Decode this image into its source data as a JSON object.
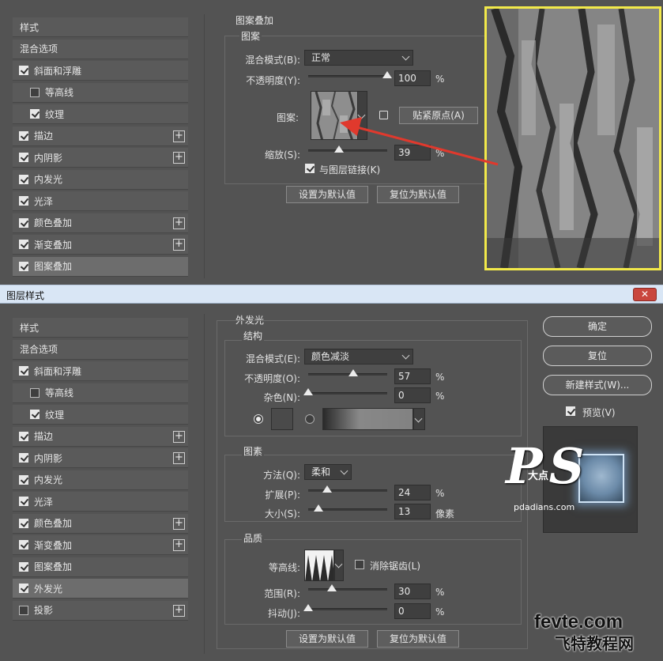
{
  "top": {
    "left_items": [
      {
        "label": "样式",
        "check": "none",
        "plus": false,
        "indent": false,
        "selected": false
      },
      {
        "label": "混合选项",
        "check": "none",
        "plus": false,
        "indent": false,
        "selected": false
      },
      {
        "label": "斜面和浮雕",
        "check": "on",
        "plus": false,
        "indent": false,
        "selected": false
      },
      {
        "label": "等高线",
        "check": "off",
        "plus": false,
        "indent": true,
        "selected": false
      },
      {
        "label": "纹理",
        "check": "on",
        "plus": false,
        "indent": true,
        "selected": false
      },
      {
        "label": "描边",
        "check": "on",
        "plus": true,
        "indent": false,
        "selected": false
      },
      {
        "label": "内阴影",
        "check": "on",
        "plus": true,
        "indent": false,
        "selected": false
      },
      {
        "label": "内发光",
        "check": "on",
        "plus": false,
        "indent": false,
        "selected": false
      },
      {
        "label": "光泽",
        "check": "on",
        "plus": false,
        "indent": false,
        "selected": false
      },
      {
        "label": "颜色叠加",
        "check": "on",
        "plus": true,
        "indent": false,
        "selected": false
      },
      {
        "label": "渐变叠加",
        "check": "on",
        "plus": true,
        "indent": false,
        "selected": false
      },
      {
        "label": "图案叠加",
        "check": "on",
        "plus": false,
        "indent": false,
        "selected": true
      }
    ],
    "section_title": "图案叠加",
    "group_title": "图案",
    "blend_label": "混合模式(B):",
    "blend_value": "正常",
    "opacity_label": "不透明度(Y):",
    "opacity_value": "100",
    "opacity_level": 100,
    "percent": "%",
    "pattern_label": "图案:",
    "snap_button": "贴紧原点(A)",
    "scale_label": "缩放(S):",
    "scale_value": "39",
    "scale_level": 39,
    "link_label": "与图层链接(K)",
    "default_button": "设置为默认值",
    "reset_button": "复位为默认值"
  },
  "dialog": {
    "title": "图层样式",
    "close": "✕",
    "left_items": [
      {
        "label": "样式",
        "check": "none",
        "plus": false,
        "indent": false,
        "selected": false
      },
      {
        "label": "混合选项",
        "check": "none",
        "plus": false,
        "indent": false,
        "selected": false
      },
      {
        "label": "斜面和浮雕",
        "check": "on",
        "plus": false,
        "indent": false,
        "selected": false
      },
      {
        "label": "等高线",
        "check": "off",
        "plus": false,
        "indent": true,
        "selected": false
      },
      {
        "label": "纹理",
        "check": "on",
        "plus": false,
        "indent": true,
        "selected": false
      },
      {
        "label": "描边",
        "check": "on",
        "plus": true,
        "indent": false,
        "selected": false
      },
      {
        "label": "内阴影",
        "check": "on",
        "plus": true,
        "indent": false,
        "selected": false
      },
      {
        "label": "内发光",
        "check": "on",
        "plus": false,
        "indent": false,
        "selected": false
      },
      {
        "label": "光泽",
        "check": "on",
        "plus": false,
        "indent": false,
        "selected": false
      },
      {
        "label": "颜色叠加",
        "check": "on",
        "plus": true,
        "indent": false,
        "selected": false
      },
      {
        "label": "渐变叠加",
        "check": "on",
        "plus": true,
        "indent": false,
        "selected": false
      },
      {
        "label": "图案叠加",
        "check": "on",
        "plus": false,
        "indent": false,
        "selected": false
      },
      {
        "label": "外发光",
        "check": "on",
        "plus": false,
        "indent": false,
        "selected": true
      },
      {
        "label": "投影",
        "check": "off",
        "plus": true,
        "indent": false,
        "selected": false
      }
    ],
    "section_title": "外发光",
    "structure": {
      "title": "结构",
      "blend_label": "混合模式(E):",
      "blend_value": "颜色减淡",
      "opacity_label": "不透明度(O):",
      "opacity_value": "57",
      "opacity_level": 57,
      "noise_label": "杂色(N):",
      "noise_value": "0",
      "noise_level": 0
    },
    "elements": {
      "title": "图素",
      "method_label": "方法(Q):",
      "method_value": "柔和",
      "spread_label": "扩展(P):",
      "spread_value": "24",
      "spread_level": 24,
      "size_label": "大小(S):",
      "size_value": "13",
      "size_level": 13,
      "size_unit": "像素"
    },
    "quality": {
      "title": "品质",
      "contour_label": "等高线:",
      "antialias_label": "消除锯齿(L)",
      "range_label": "范围(R):",
      "range_value": "30",
      "range_level": 30,
      "jitter_label": "抖动(J):",
      "jitter_value": "0",
      "jitter_level": 0
    },
    "percent": "%",
    "default_button": "设置为默认值",
    "reset_button": "复位为默认值",
    "ok_button": "确定",
    "cancel_button": "复位",
    "new_style_button": "新建样式(W)...",
    "preview_label": "预览(V)"
  },
  "watermark": {
    "ps_letters": "PS",
    "ps_chinese": "大点",
    "ps_site": "pdadians.com",
    "fevte_site": "fevte.com",
    "fevte_chinese": "飞特教程网"
  },
  "colors": {
    "panel_bg": "#535353",
    "highlight_frame": "#f2e94a",
    "arrow": "#e0392d",
    "titlebar": "#d9e6f5",
    "close_button": "#c9463d"
  }
}
